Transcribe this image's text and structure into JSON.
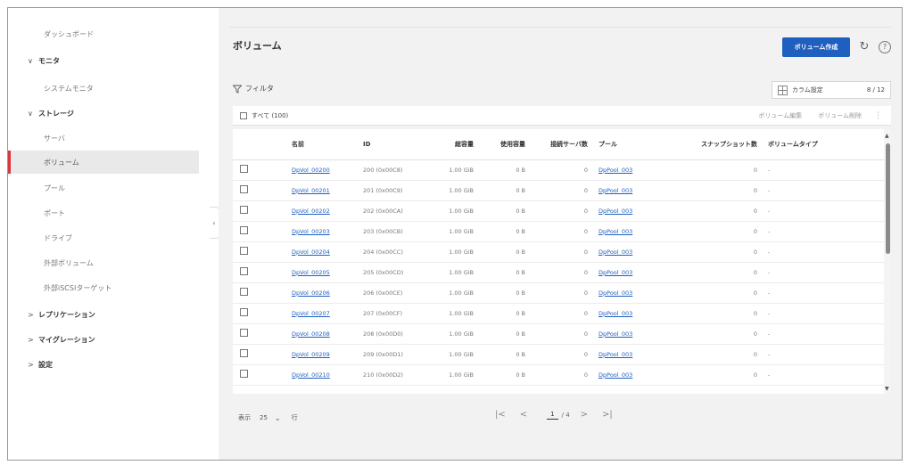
{
  "sidebar": {
    "items": [
      {
        "label": "ダッシュボード",
        "type": "child",
        "active": false
      },
      {
        "label": "モニタ",
        "type": "group",
        "expanded": true
      },
      {
        "label": "システムモニタ",
        "type": "child",
        "active": false
      },
      {
        "label": "ストレージ",
        "type": "group",
        "expanded": true
      },
      {
        "label": "サーバ",
        "type": "child",
        "active": false
      },
      {
        "label": "ボリューム",
        "type": "child",
        "active": true
      },
      {
        "label": "プール",
        "type": "child",
        "active": false
      },
      {
        "label": "ポート",
        "type": "child",
        "active": false
      },
      {
        "label": "ドライブ",
        "type": "child",
        "active": false
      },
      {
        "label": "外部ボリューム",
        "type": "child",
        "active": false
      },
      {
        "label": "外部iSCSIターゲット",
        "type": "child",
        "active": false
      },
      {
        "label": "レプリケーション",
        "type": "group",
        "expanded": false
      },
      {
        "label": "マイグレーション",
        "type": "group",
        "expanded": false
      },
      {
        "label": "設定",
        "type": "group",
        "expanded": false
      }
    ],
    "collapse_glyph": "‹"
  },
  "header": {
    "title": "ボリューム",
    "create_label": "ボリューム作成",
    "refresh_glyph": "↻",
    "help_glyph": "?"
  },
  "filter": {
    "label": "フィルタ"
  },
  "column_settings": {
    "label": "カラム設定",
    "count": "8 / 12"
  },
  "toolbar": {
    "select_all": "すべて (100)",
    "edit_label": "ボリューム編集",
    "delete_label": "ボリューム削除",
    "more_glyph": "⋮"
  },
  "table": {
    "columns": [
      "名前",
      "ID",
      "総容量",
      "使用容量",
      "接続サーバ数",
      "プール",
      "スナップショット数",
      "ボリュームタイプ"
    ],
    "rows": [
      [
        "DpVol_00200",
        "200 (0x00C8)",
        "1.00 GiB",
        "0 B",
        "0",
        "DpPool_003",
        "0",
        "-"
      ],
      [
        "DpVol_00201",
        "201 (0x00C9)",
        "1.00 GiB",
        "0 B",
        "0",
        "DpPool_003",
        "0",
        "-"
      ],
      [
        "DpVol_00202",
        "202 (0x00CA)",
        "1.00 GiB",
        "0 B",
        "0",
        "DpPool_003",
        "0",
        "-"
      ],
      [
        "DpVol_00203",
        "203 (0x00CB)",
        "1.00 GiB",
        "0 B",
        "0",
        "DpPool_003",
        "0",
        "-"
      ],
      [
        "DpVol_00204",
        "204 (0x00CC)",
        "1.00 GiB",
        "0 B",
        "0",
        "DpPool_003",
        "0",
        "-"
      ],
      [
        "DpVol_00205",
        "205 (0x00CD)",
        "1.00 GiB",
        "0 B",
        "0",
        "DpPool_003",
        "0",
        "-"
      ],
      [
        "DpVol_00206",
        "206 (0x00CE)",
        "1.00 GiB",
        "0 B",
        "0",
        "DpPool_003",
        "0",
        "-"
      ],
      [
        "DpVol_00207",
        "207 (0x00CF)",
        "1.00 GiB",
        "0 B",
        "0",
        "DpPool_003",
        "0",
        "-"
      ],
      [
        "DpVol_00208",
        "208 (0x00D0)",
        "1.00 GiB",
        "0 B",
        "0",
        "DpPool_003",
        "0",
        "-"
      ],
      [
        "DpVol_00209",
        "209 (0x00D1)",
        "1.00 GiB",
        "0 B",
        "0",
        "DpPool_003",
        "0",
        "-"
      ],
      [
        "DpVol_00210",
        "210 (0x00D2)",
        "1.00 GiB",
        "0 B",
        "0",
        "DpPool_003",
        "0",
        "-"
      ]
    ]
  },
  "pagination": {
    "display_label": "表示",
    "page_size": "25",
    "unit": "行",
    "current_page": "1",
    "total_pages": "/ 4",
    "first_glyph": "|<",
    "prev_glyph": "<",
    "next_glyph": ">",
    "last_glyph": ">|"
  },
  "colors": {
    "accent": "#1f5fbf",
    "active_marker": "#d9363e",
    "content_bg": "#f2f2f2"
  }
}
